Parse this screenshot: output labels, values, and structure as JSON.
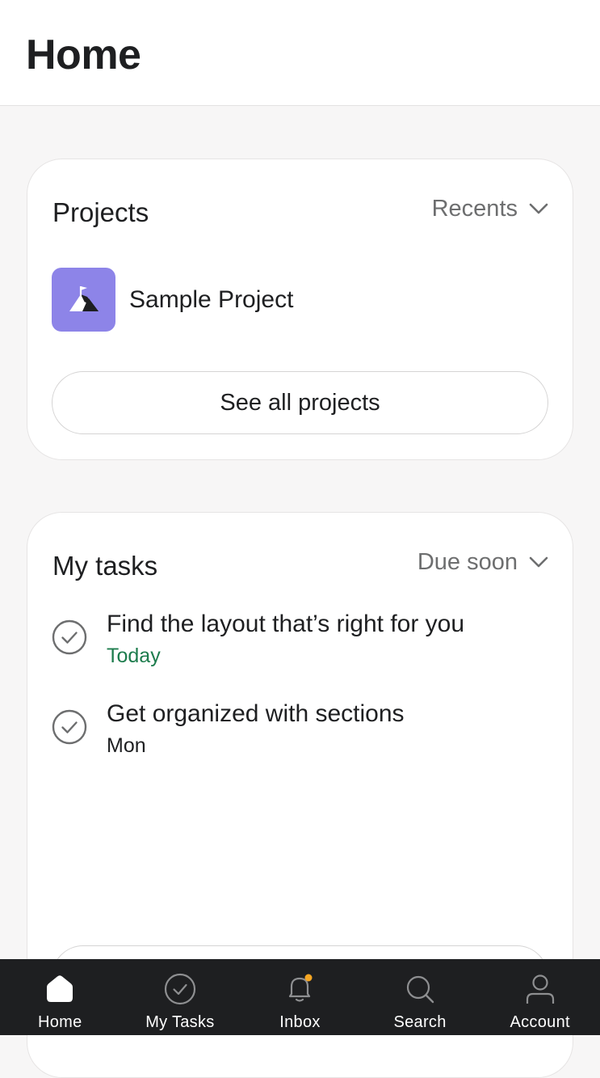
{
  "header": {
    "title": "Home"
  },
  "projects": {
    "title": "Projects",
    "filter_label": "Recents",
    "items": [
      {
        "name": "Sample Project",
        "icon": "mountain-flag-icon",
        "color": "#8d84e8"
      }
    ],
    "see_all_label": "See all projects"
  },
  "tasks": {
    "title": "My tasks",
    "filter_label": "Due soon",
    "items": [
      {
        "name": "Find the layout that’s right for you",
        "due": "Today",
        "due_color": "#1d7c4d"
      },
      {
        "name": "Get organized with sections",
        "due": "Mon",
        "due_color": "#1e1f21"
      }
    ]
  },
  "tabbar": {
    "items": [
      {
        "label": "Home",
        "icon": "home-icon",
        "active": true
      },
      {
        "label": "My Tasks",
        "icon": "check-circle-icon",
        "active": false
      },
      {
        "label": "Inbox",
        "icon": "bell-icon",
        "active": false,
        "notification_dot_color": "#f5a623"
      },
      {
        "label": "Search",
        "icon": "search-icon",
        "active": false
      },
      {
        "label": "Account",
        "icon": "user-icon",
        "active": false
      }
    ]
  },
  "colors": {
    "background": "#f7f6f6",
    "card": "#ffffff",
    "tabbar": "#1e1f21",
    "accent_green": "#1d7c4d"
  }
}
